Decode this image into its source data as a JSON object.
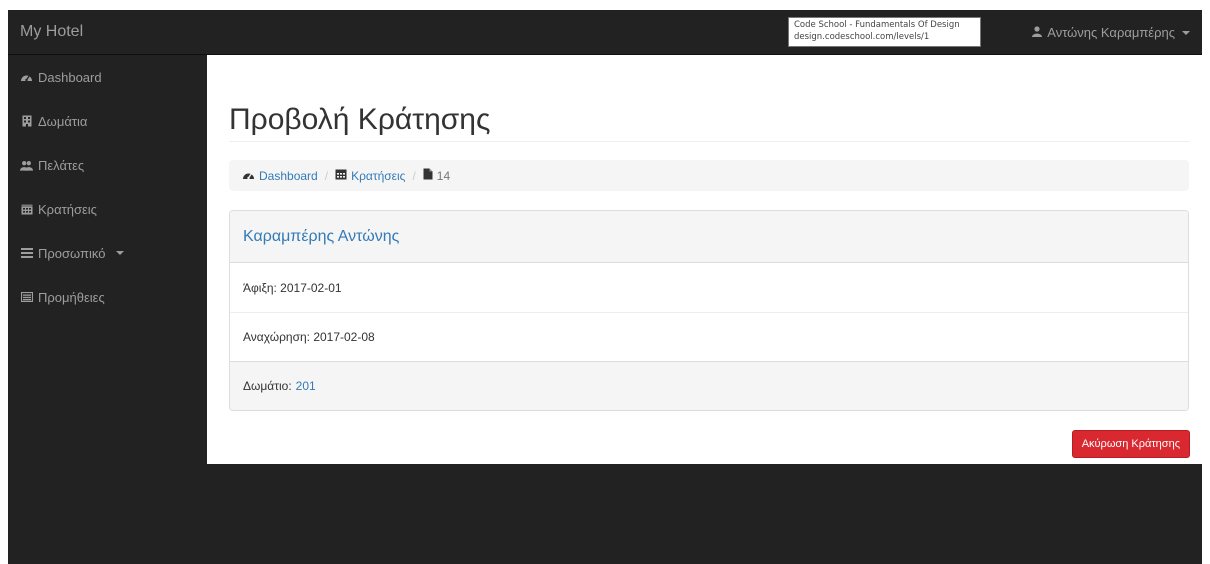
{
  "navbar": {
    "brand": "My Hotel",
    "user": "Αντώνης Καραμπέρης",
    "user_icon": "user-icon"
  },
  "tooltip": {
    "line1": "Code School - Fundamentals Of Design",
    "line2": "design.codeschool.com/levels/1"
  },
  "sidebar": {
    "items": [
      {
        "label": "Dashboard",
        "icon": "dashboard-icon"
      },
      {
        "label": "Δωμάτια",
        "icon": "building-icon"
      },
      {
        "label": "Πελάτες",
        "icon": "users-icon"
      },
      {
        "label": "Κρατήσεις",
        "icon": "calendar-icon"
      },
      {
        "label": "Προσωπικό",
        "icon": "list-icon"
      },
      {
        "label": "Προμήθειες",
        "icon": "list-alt-icon"
      }
    ]
  },
  "page": {
    "title": "Προβολή Κράτησης"
  },
  "breadcrumb": {
    "items": [
      {
        "label": "Dashboard",
        "icon": "dashboard-icon"
      },
      {
        "label": "Κρατήσεις",
        "icon": "calendar-icon"
      },
      {
        "label": "14",
        "icon": "file-icon"
      }
    ]
  },
  "reservation": {
    "guest_name": "Καραμπέρης Αντώνης",
    "arrival": "Άφιξη: 2017-02-01",
    "departure": "Αναχώρηση: 2017-02-08",
    "room_label": "Δωμάτιο:",
    "room_number": "201"
  },
  "actions": {
    "cancel_label": "Ακύρωση Κράτησης"
  },
  "colors": {
    "navbar_bg": "#222222",
    "link": "#337ab7",
    "danger": "#d9282f"
  }
}
